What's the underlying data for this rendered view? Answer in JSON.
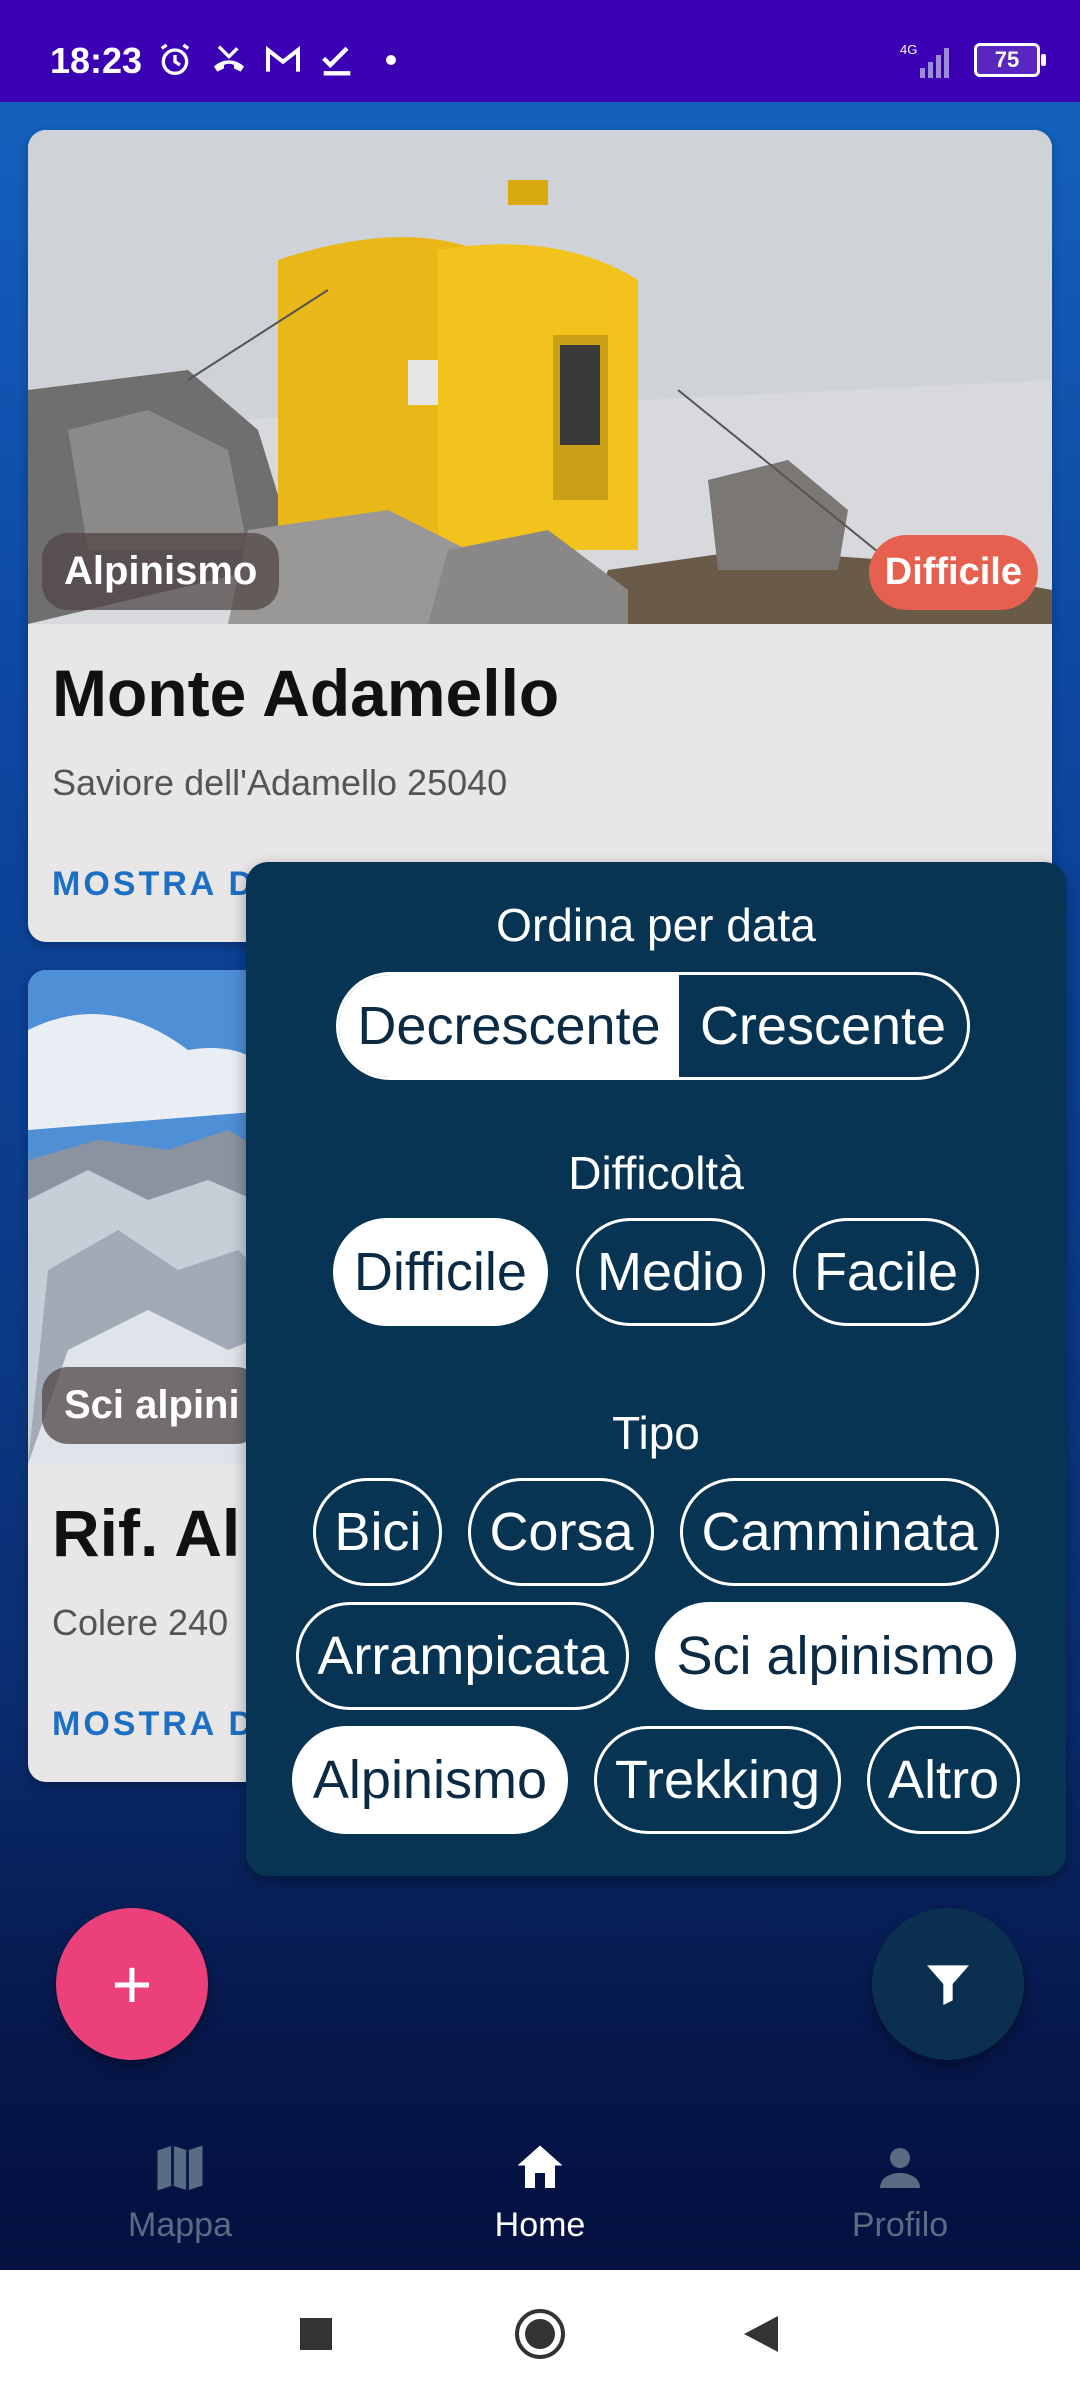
{
  "status_bar": {
    "time": "18:23",
    "network": "4G",
    "battery": "75",
    "icons": [
      "alarm-icon",
      "missed-call-icon",
      "gmail-icon",
      "task-done-icon",
      "dot-icon",
      "signal-icon",
      "battery-icon"
    ]
  },
  "cards": [
    {
      "type_chip": "Alpinismo",
      "difficulty_chip": "Difficile",
      "title": "Monte Adamello",
      "subtitle": "Saviore dell'Adamello 25040",
      "action": "MOSTRA D"
    },
    {
      "type_chip": "Sci alpini",
      "title": "Rif. Al",
      "subtitle": "Colere 240",
      "action": "MOSTRA D"
    }
  ],
  "filter": {
    "sort_title": "Ordina per data",
    "sort_options": [
      "Decrescente",
      "Crescente"
    ],
    "sort_selected": "Decrescente",
    "difficulty_title": "Difficoltà",
    "difficulty_options": [
      "Difficile",
      "Medio",
      "Facile"
    ],
    "difficulty_selected": "Difficile",
    "type_title": "Tipo",
    "type_options": [
      "Bici",
      "Corsa",
      "Camminata",
      "Arrampicata",
      "Sci alpinismo",
      "Alpinismo",
      "Trekking",
      "Altro"
    ],
    "type_selected": [
      "Sci alpinismo",
      "Alpinismo"
    ]
  },
  "fab": {
    "add_label": "+"
  },
  "bottom_nav": {
    "items": [
      {
        "label": "Mappa",
        "icon": "map-icon"
      },
      {
        "label": "Home",
        "icon": "home-icon"
      },
      {
        "label": "Profilo",
        "icon": "person-icon"
      }
    ],
    "active": "Home"
  },
  "colors": {
    "status_bar": "#3c00b4",
    "panel": "#073452",
    "fab_add": "#ec407a",
    "difficulty_chip": "#e6604f",
    "action_text": "#1b6fc4"
  }
}
